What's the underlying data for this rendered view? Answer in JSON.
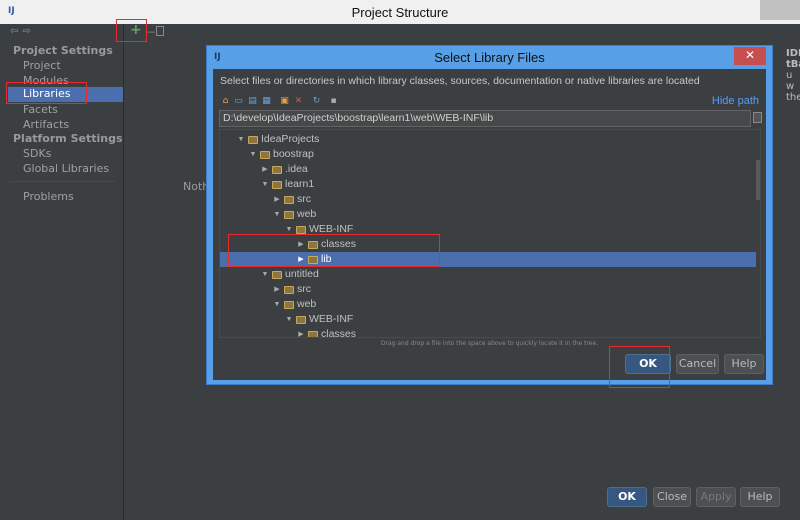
{
  "window": {
    "title": "Project Structure",
    "app_icon": "IJ"
  },
  "sidebar": {
    "nav_back": "⇦",
    "nav_forward": "⇨",
    "project_settings_header": "Project Settings",
    "items": [
      {
        "label": "Project"
      },
      {
        "label": "Modules"
      },
      {
        "label": "Libraries"
      },
      {
        "label": "Facets"
      },
      {
        "label": "Artifacts"
      }
    ],
    "platform_settings_header": "Platform Settings",
    "platform_items": [
      {
        "label": "SDKs"
      },
      {
        "label": "Global Libraries"
      }
    ],
    "problems_label": "Problems"
  },
  "middle": {
    "add_label": "+",
    "remove_label": "−",
    "nothing_label": "Noth"
  },
  "footer": {
    "ok": "OK",
    "close": "Close",
    "apply": "Apply",
    "help": "Help"
  },
  "dialog": {
    "title": "Select Library Files",
    "close_label": "✕",
    "icon": "IJ",
    "description": "Select files or directories in which library classes, sources, documentation or native libraries are located",
    "hide_path": "Hide path",
    "path": "D:\\develop\\IdeaProjects\\boostrap\\learn1\\web\\WEB-INF\\lib",
    "drag_hint": "Drag and drop a file into the space above to quickly locate it in the tree.",
    "ok": "OK",
    "cancel": "Cancel",
    "help": "Help",
    "tree": [
      {
        "label": "IdeaProjects",
        "expanded": true
      },
      {
        "label": "boostrap",
        "expanded": true
      },
      {
        "label": ".idea",
        "expanded": false
      },
      {
        "label": "learn1",
        "expanded": true
      },
      {
        "label": "src",
        "expanded": false
      },
      {
        "label": "web",
        "expanded": true
      },
      {
        "label": "WEB-INF",
        "expanded": true
      },
      {
        "label": "classes",
        "expanded": false
      },
      {
        "label": "lib",
        "expanded": false,
        "selected": true
      },
      {
        "label": "untitled",
        "expanded": true
      },
      {
        "label": "src",
        "expanded": false
      },
      {
        "label": "web",
        "expanded": true
      },
      {
        "label": "WEB-INF",
        "expanded": true
      },
      {
        "label": "classes",
        "expanded": false
      }
    ]
  },
  "peek": {
    "line1": "IDI",
    "line2": "tBa",
    "line3": "u w",
    "line4": "the"
  },
  "colors": {
    "accent": "#4b6eaf",
    "dialog_frame": "#57a0e8",
    "highlight_box": "#e52d2d",
    "background": "#3c3f41"
  }
}
